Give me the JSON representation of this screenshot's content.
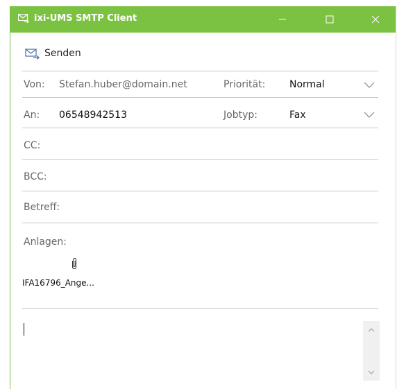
{
  "window": {
    "title": "ixi-UMS SMTP Client",
    "accent_color": "#7cc242",
    "controls": {
      "minimize_icon": "minimize-icon",
      "maximize_icon": "maximize-icon",
      "close_icon": "close-icon"
    }
  },
  "toolbar": {
    "send_label": "Senden",
    "send_icon": "envelope-send-icon"
  },
  "fields": {
    "from_label": "Von:",
    "from_value": "Stefan.huber@domain.net",
    "priority_label": "Priorität:",
    "priority_value": "Normal",
    "to_label": "An:",
    "to_value": "06548942513",
    "jobtype_label": "Jobtyp:",
    "jobtype_value": "Fax",
    "cc_label": "CC:",
    "bcc_label": "BCC:",
    "subject_label": "Betreff:",
    "attachments_label": "Anlagen:"
  },
  "attachments": [
    {
      "name": "IFA16796_Ange...",
      "icon": "paperclip-icon"
    }
  ],
  "body": {
    "text": ""
  }
}
